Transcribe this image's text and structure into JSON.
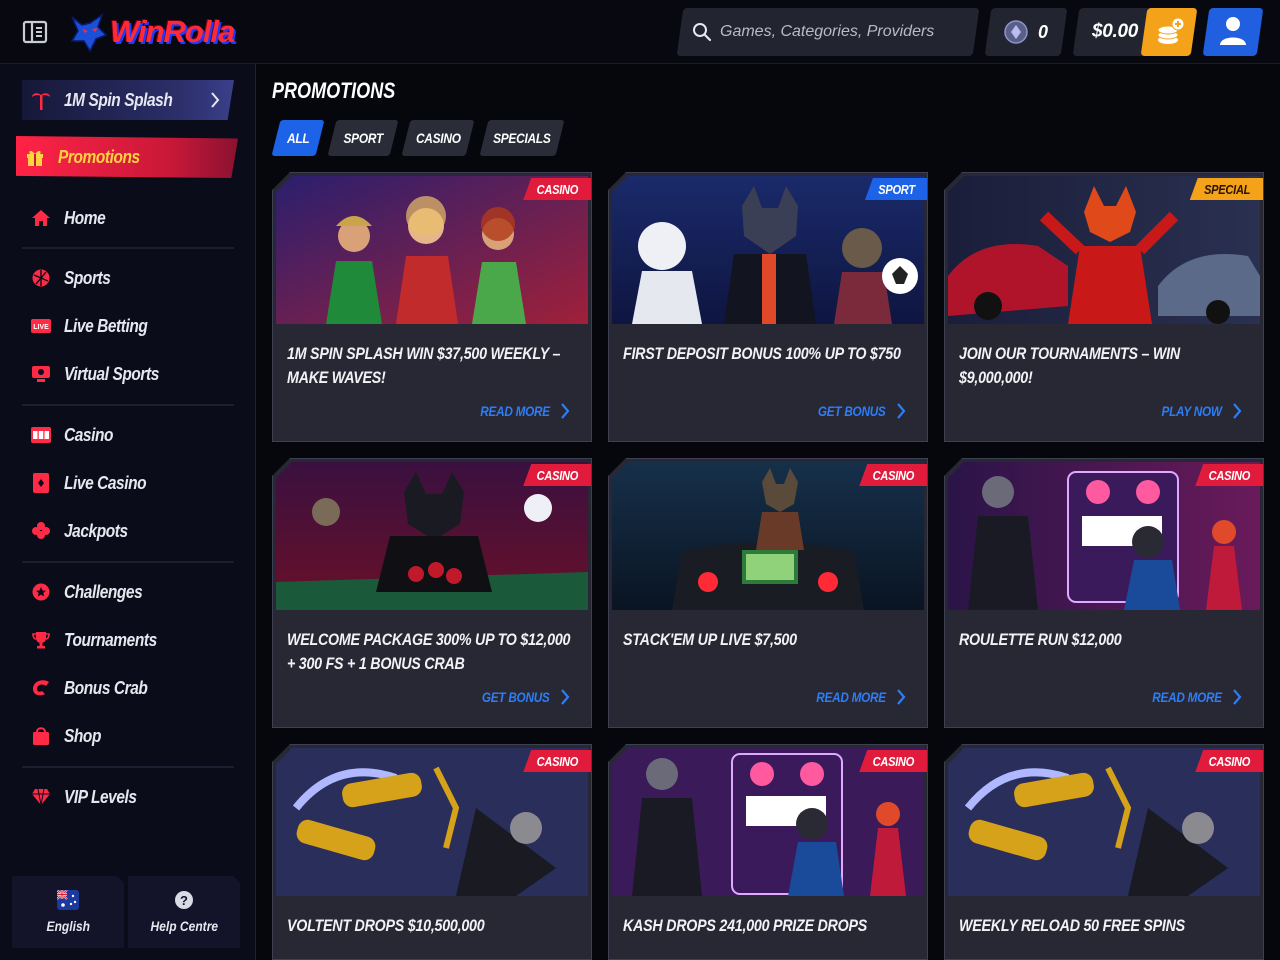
{
  "header": {
    "logo_text": "WinRolla",
    "search_placeholder": "Games, Categories, Providers",
    "gems_count": "0",
    "balance": "$0.00"
  },
  "sidebar": {
    "featured": {
      "label": "1M Spin Splash"
    },
    "active": {
      "label": "Promotions"
    },
    "items": [
      {
        "label": "Home"
      },
      {
        "label": "Sports"
      },
      {
        "label": "Live Betting"
      },
      {
        "label": "Virtual Sports"
      },
      {
        "label": "Casino"
      },
      {
        "label": "Live Casino"
      },
      {
        "label": "Jackpots"
      },
      {
        "label": "Challenges"
      },
      {
        "label": "Tournaments"
      },
      {
        "label": "Bonus Crab"
      },
      {
        "label": "Shop"
      },
      {
        "label": "VIP Levels"
      }
    ],
    "footer": {
      "language": "English",
      "help": "Help Centre"
    }
  },
  "main": {
    "title": "Promotions",
    "tabs": [
      {
        "label": "All",
        "active": true
      },
      {
        "label": "Sport",
        "active": false
      },
      {
        "label": "Casino",
        "active": false
      },
      {
        "label": "Specials",
        "active": false
      }
    ],
    "cards": [
      {
        "badge": "Casino",
        "title": "1M Spin Splash Win $37,500 Weekly –\nMake Waves!",
        "cta": "Read More"
      },
      {
        "badge": "Sport",
        "title": "First Deposit Bonus 100% up to $750",
        "cta": "Get Bonus"
      },
      {
        "badge": "Special",
        "title": "Join our Tournaments – Win $9,000,000!",
        "cta": "Play Now"
      },
      {
        "badge": "Casino",
        "title": "Welcome Package 300% up to $12,000\n+ 300 FS + 1 Bonus Crab",
        "cta": "Get Bonus"
      },
      {
        "badge": "Casino",
        "title": "Stack'Em Up Live $7,500",
        "cta": "Read More"
      },
      {
        "badge": "Casino",
        "title": "Roulette Run $12,000",
        "cta": "Read More"
      },
      {
        "badge": "Casino",
        "title": "Voltent Drops $10,500,000",
        "cta": ""
      },
      {
        "badge": "Casino",
        "title": "Kash Drops 241,000 Prize Drops",
        "cta": ""
      },
      {
        "badge": "Casino",
        "title": "Weekly Reload 50 Free Spins",
        "cta": ""
      }
    ]
  },
  "colors": {
    "accent_blue": "#1c63e8",
    "accent_red": "#e01b3c",
    "accent_gold": "#f4a21a",
    "link_blue": "#2d7df6",
    "promo_label": "#ffd23f"
  }
}
